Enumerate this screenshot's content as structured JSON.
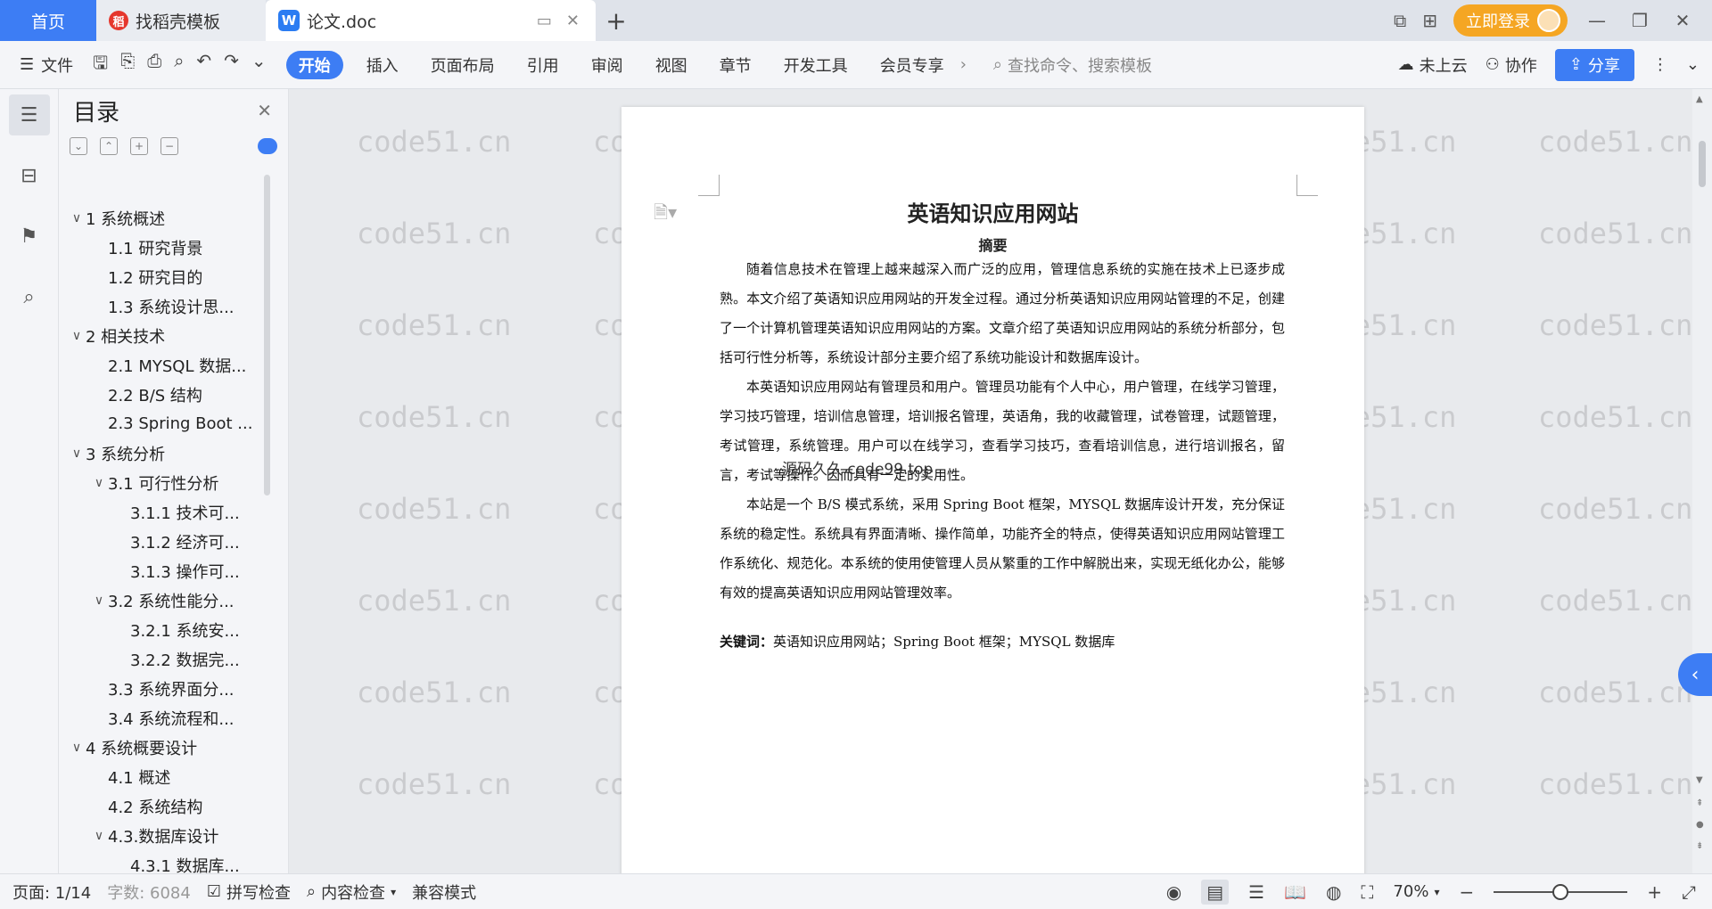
{
  "tabs": {
    "home": "首页",
    "template": "找稻壳模板",
    "doc": "论文.doc",
    "login": "立即登录"
  },
  "ribbon": {
    "file": "文件",
    "tabs": [
      "开始",
      "插入",
      "页面布局",
      "引用",
      "审阅",
      "视图",
      "章节",
      "开发工具",
      "会员专享"
    ],
    "search_placeholder": "查找命令、搜索模板",
    "cloud": "未上云",
    "collab": "协作",
    "share": "分享"
  },
  "toc": {
    "title": "目录",
    "items": [
      {
        "label": "1 系统概述",
        "level": "lvl1",
        "caret": "∨"
      },
      {
        "label": "1.1  研究背景",
        "level": "lvl2nc",
        "caret": ""
      },
      {
        "label": "1.2 研究目的",
        "level": "lvl2nc",
        "caret": ""
      },
      {
        "label": "1.3 系统设计思...",
        "level": "lvl2nc",
        "caret": ""
      },
      {
        "label": "2 相关技术",
        "level": "lvl1",
        "caret": "∨"
      },
      {
        "label": "2.1 MYSQL 数据...",
        "level": "lvl2nc",
        "caret": ""
      },
      {
        "label": "2.2 B/S 结构",
        "level": "lvl2nc",
        "caret": ""
      },
      {
        "label": "2.3 Spring Boot ...",
        "level": "lvl2nc",
        "caret": ""
      },
      {
        "label": "3 系统分析",
        "level": "lvl1",
        "caret": "∨"
      },
      {
        "label": "3.1 可行性分析",
        "level": "lvl2",
        "caret": "∨"
      },
      {
        "label": "3.1.1 技术可...",
        "level": "lvl3",
        "caret": ""
      },
      {
        "label": "3.1.2 经济可...",
        "level": "lvl3",
        "caret": ""
      },
      {
        "label": "3.1.3 操作可...",
        "level": "lvl3",
        "caret": ""
      },
      {
        "label": "3.2 系统性能分...",
        "level": "lvl2",
        "caret": "∨"
      },
      {
        "label": "3.2.1  系统安...",
        "level": "lvl3",
        "caret": ""
      },
      {
        "label": "3.2.2  数据完...",
        "level": "lvl3",
        "caret": ""
      },
      {
        "label": "3.3 系统界面分...",
        "level": "lvl2nc",
        "caret": ""
      },
      {
        "label": "3.4 系统流程和...",
        "level": "lvl2nc",
        "caret": ""
      },
      {
        "label": "4 系统概要设计",
        "level": "lvl1",
        "caret": "∨"
      },
      {
        "label": "4.1 概述",
        "level": "lvl2nc",
        "caret": ""
      },
      {
        "label": "4.2 系统结构",
        "level": "lvl2nc",
        "caret": ""
      },
      {
        "label": "4.3.数据库设计",
        "level": "lvl2",
        "caret": "∨"
      },
      {
        "label": "4.3.1 数据库...",
        "level": "lvl3",
        "caret": ""
      }
    ]
  },
  "document": {
    "title": "英语知识应用网站",
    "abstract_title": "摘要",
    "paragraphs": [
      "随着信息技术在管理上越来越深入而广泛的应用，管理信息系统的实施在技术上已逐步成熟。本文介绍了英语知识应用网站的开发全过程。通过分析英语知识应用网站管理的不足，创建了一个计算机管理英语知识应用网站的方案。文章介绍了英语知识应用网站的系统分析部分，包括可行性分析等，系统设计部分主要介绍了系统功能设计和数据库设计。",
      "本英语知识应用网站有管理员和用户。管理员功能有个人中心，用户管理，在线学习管理，学习技巧管理，培训信息管理，培训报名管理，英语角，我的收藏管理，试卷管理，试题管理，考试管理，系统管理。用户可以在线学习，查看学习技巧，查看培训信息，进行培训报名，留言，考试等操作。因而具有一定的实用性。",
      "本站是一个 B/S 模式系统，采用 Spring Boot 框架，MYSQL 数据库设计开发，充分保证系统的稳定性。系统具有界面清晰、操作简单，功能齐全的特点，使得英语知识应用网站管理工作系统化、规范化。本系统的使用使管理人员从繁重的工作中解脱出来，实现无纸化办公，能够有效的提高英语知识应用网站管理效率。"
    ],
    "keywords_label": "关键词：",
    "keywords": "英语知识应用网站；Spring Boot 框架；MYSQL 数据库",
    "inline_watermark": "源码久久 code99.top"
  },
  "watermark": "code51.cn",
  "status": {
    "page": "页面: 1/14",
    "words": "字数: 6084",
    "spell": "拼写检查",
    "content": "内容检查",
    "compat": "兼容模式",
    "zoom": "70%",
    "zoom_level": 0.5
  },
  "colors": {
    "accent": "#3d7df4",
    "login": "#f5a623"
  }
}
